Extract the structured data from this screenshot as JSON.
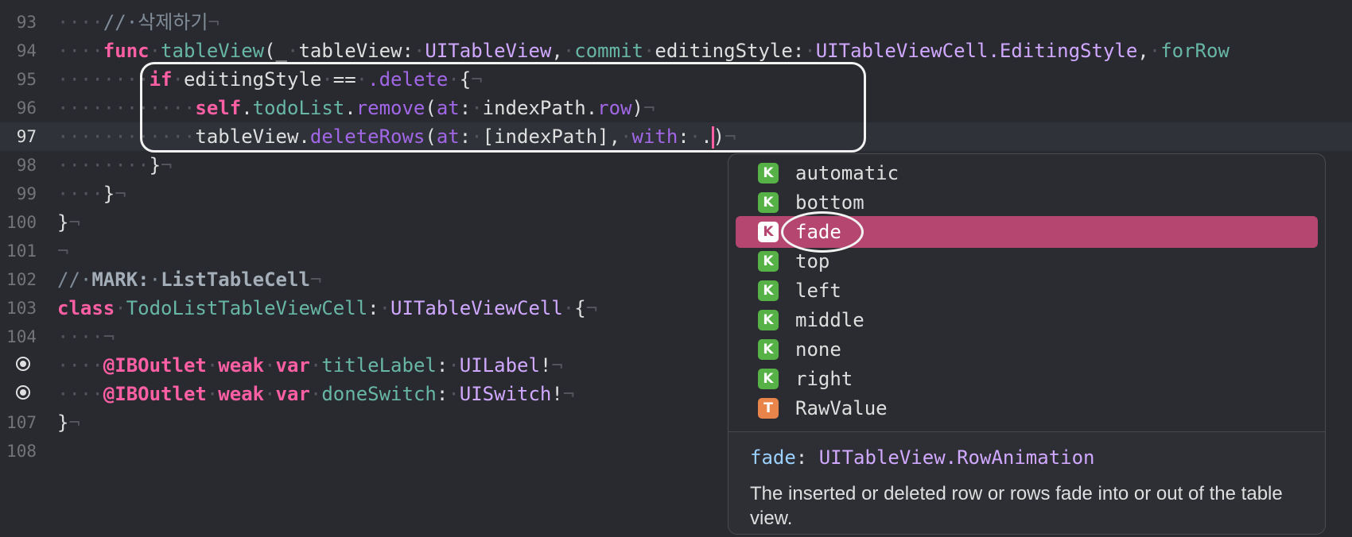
{
  "editor": {
    "lines": [
      {
        "num": "93",
        "tokens": [
          [
            "ws",
            "····"
          ],
          [
            "cm",
            "//·삭제하기"
          ],
          [
            "ws",
            "¬"
          ]
        ]
      },
      {
        "num": "94",
        "tokens": [
          [
            "ws",
            "····"
          ],
          [
            "kw",
            "func"
          ],
          [
            "ws",
            "·"
          ],
          [
            "fn",
            "tableView"
          ],
          [
            "",
            "("
          ],
          [
            "",
            "_"
          ],
          [
            "ws",
            "·"
          ],
          [
            "",
            "tableView:"
          ],
          [
            "ws",
            "·"
          ],
          [
            "ty",
            "UITableView"
          ],
          [
            "",
            ","
          ],
          [
            "ws",
            "·"
          ],
          [
            "fn",
            "commit"
          ],
          [
            "ws",
            "·"
          ],
          [
            "",
            "editingStyle:"
          ],
          [
            "ws",
            "·"
          ],
          [
            "ty",
            "UITableViewCell.EditingStyle"
          ],
          [
            "",
            ","
          ],
          [
            "ws",
            "·"
          ],
          [
            "fn",
            "forRow"
          ]
        ]
      },
      {
        "num": "95",
        "tokens": [
          [
            "ws",
            "········"
          ],
          [
            "kw",
            "if"
          ],
          [
            "ws",
            "·"
          ],
          [
            "",
            "editingStyle"
          ],
          [
            "ws",
            "·"
          ],
          [
            "",
            "=="
          ],
          [
            "ws",
            "·"
          ],
          [
            "prj",
            ".delete"
          ],
          [
            "ws",
            "·"
          ],
          [
            "",
            "{"
          ],
          [
            "ws",
            "¬"
          ]
        ]
      },
      {
        "num": "96",
        "tokens": [
          [
            "ws",
            "············"
          ],
          [
            "kw",
            "self"
          ],
          [
            "",
            "."
          ],
          [
            "fn",
            "todoList"
          ],
          [
            "",
            "."
          ],
          [
            "prj",
            "remove"
          ],
          [
            "",
            "("
          ],
          [
            "prj",
            "at"
          ],
          [
            "",
            ":"
          ],
          [
            "ws",
            "·"
          ],
          [
            "",
            "indexPath."
          ],
          [
            "prj",
            "row"
          ],
          [
            "",
            ")"
          ],
          [
            "ws",
            "¬"
          ]
        ]
      },
      {
        "num": "97",
        "current": true,
        "tokens": [
          [
            "ws",
            "············"
          ],
          [
            "",
            "tableView."
          ],
          [
            "prj",
            "deleteRows"
          ],
          [
            "",
            "("
          ],
          [
            "prj",
            "at"
          ],
          [
            "",
            ":"
          ],
          [
            "ws",
            "·"
          ],
          [
            "",
            "[indexPath],"
          ],
          [
            "ws",
            "·"
          ],
          [
            "prj",
            "with"
          ],
          [
            "",
            ":"
          ],
          [
            "ws",
            "·"
          ],
          [
            "",
            "."
          ],
          [
            "caret",
            ""
          ],
          [
            "",
            ")"
          ],
          [
            "ws",
            "¬"
          ]
        ]
      },
      {
        "num": "98",
        "tokens": [
          [
            "ws",
            "········"
          ],
          [
            "",
            "}"
          ],
          [
            "ws",
            "¬"
          ]
        ]
      },
      {
        "num": "99",
        "tokens": [
          [
            "ws",
            "····"
          ],
          [
            "",
            "}"
          ],
          [
            "ws",
            "¬"
          ]
        ]
      },
      {
        "num": "100",
        "tokens": [
          [
            "",
            "}"
          ],
          [
            "ws",
            "¬"
          ]
        ]
      },
      {
        "num": "101",
        "tokens": [
          [
            "ws",
            "¬"
          ]
        ]
      },
      {
        "num": "102",
        "tokens": [
          [
            "cm",
            "//·"
          ],
          [
            "cmb",
            "MARK:"
          ],
          [
            "cm",
            "·"
          ],
          [
            "cmb",
            "ListTableCell"
          ],
          [
            "ws",
            "¬"
          ]
        ]
      },
      {
        "num": "103",
        "tokens": [
          [
            "kw",
            "class"
          ],
          [
            "ws",
            "·"
          ],
          [
            "fn",
            "TodoListTableViewCell"
          ],
          [
            "",
            ":"
          ],
          [
            "ws",
            "·"
          ],
          [
            "ty",
            "UITableViewCell"
          ],
          [
            "ws",
            "·"
          ],
          [
            "",
            "{"
          ],
          [
            "ws",
            "¬"
          ]
        ]
      },
      {
        "num": "104",
        "tokens": [
          [
            "ws",
            "····¬"
          ]
        ]
      },
      {
        "num": "",
        "breakpoint": true,
        "tokens": [
          [
            "ws",
            "····"
          ],
          [
            "kw",
            "@IBOutlet"
          ],
          [
            "ws",
            "·"
          ],
          [
            "kw",
            "weak"
          ],
          [
            "ws",
            "·"
          ],
          [
            "kw",
            "var"
          ],
          [
            "ws",
            "·"
          ],
          [
            "fn",
            "titleLabel"
          ],
          [
            "",
            ":"
          ],
          [
            "ws",
            "·"
          ],
          [
            "ty",
            "UILabel"
          ],
          [
            "",
            "!"
          ],
          [
            "ws",
            "¬"
          ]
        ]
      },
      {
        "num": "",
        "breakpoint": true,
        "tokens": [
          [
            "ws",
            "····"
          ],
          [
            "kw",
            "@IBOutlet"
          ],
          [
            "ws",
            "·"
          ],
          [
            "kw",
            "weak"
          ],
          [
            "ws",
            "·"
          ],
          [
            "kw",
            "var"
          ],
          [
            "ws",
            "·"
          ],
          [
            "fn",
            "doneSwitch"
          ],
          [
            "",
            ":"
          ],
          [
            "ws",
            "·"
          ],
          [
            "ty",
            "UISwitch"
          ],
          [
            "",
            "!"
          ],
          [
            "ws",
            "¬"
          ]
        ]
      },
      {
        "num": "107",
        "tokens": [
          [
            "",
            "}"
          ],
          [
            "ws",
            "¬"
          ]
        ]
      },
      {
        "num": "108",
        "tokens": []
      }
    ]
  },
  "completion": {
    "items": [
      {
        "badge": "K",
        "label": "automatic"
      },
      {
        "badge": "K",
        "label": "bottom"
      },
      {
        "badge": "K",
        "label": "fade",
        "selected": true
      },
      {
        "badge": "K",
        "label": "top"
      },
      {
        "badge": "K",
        "label": "left"
      },
      {
        "badge": "K",
        "label": "middle"
      },
      {
        "badge": "K",
        "label": "none"
      },
      {
        "badge": "K",
        "label": "right"
      },
      {
        "badge": "T",
        "label": "RawValue",
        "badge_color": "orange"
      }
    ],
    "doc": {
      "name": "fade",
      "colon": ": ",
      "type": "UITableView.RowAnimation",
      "description": "The inserted or deleted row or rows fade into or out of the table view."
    }
  },
  "colors": {
    "background": "#292a30",
    "keyword": "#fc5fa3",
    "type": "#d0a8ff",
    "function": "#67b7a4",
    "project": "#a167e6",
    "selection": "#b4466f",
    "badge_keyword": "#56b146",
    "badge_type": "#e9854b"
  }
}
